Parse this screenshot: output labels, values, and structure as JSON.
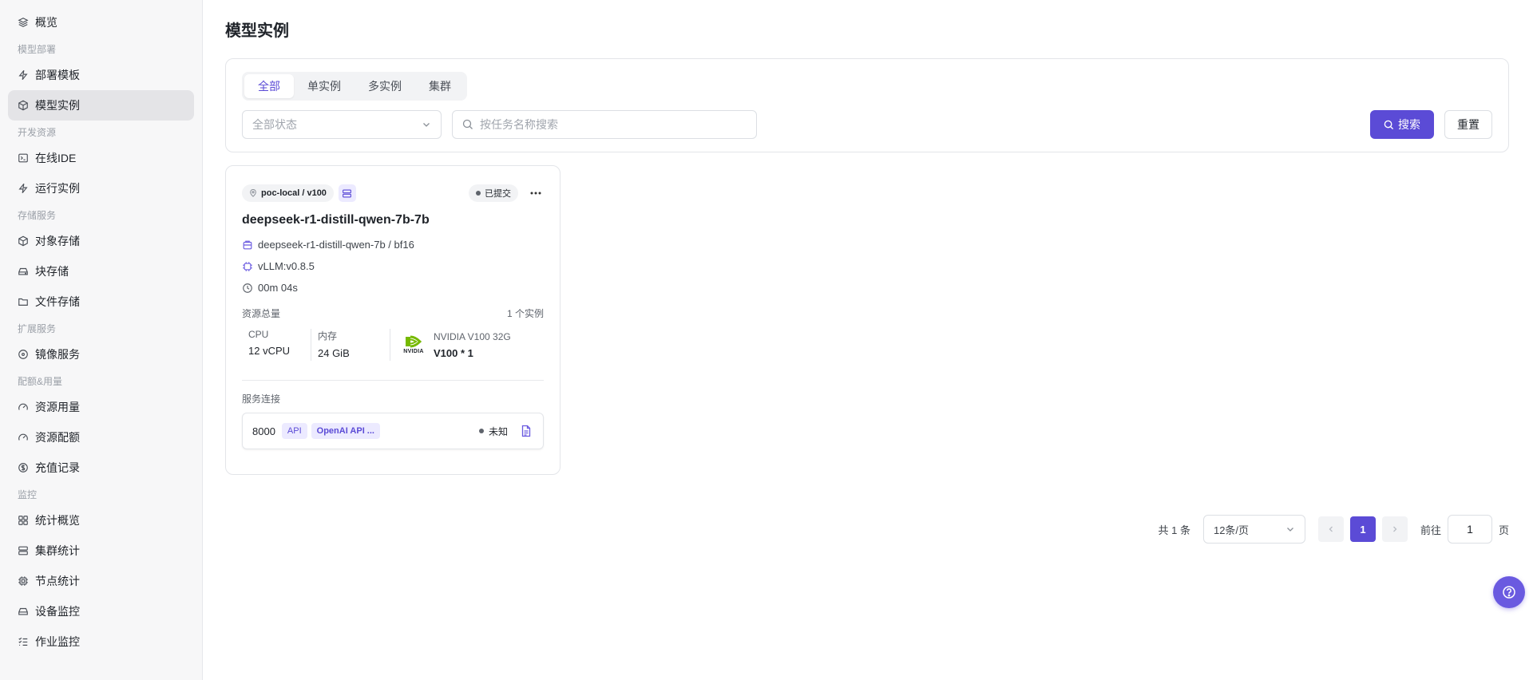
{
  "sidebar": {
    "overview": "概览",
    "groups": {
      "deploy": "模型部署",
      "dev": "开发资源",
      "storage": "存储服务",
      "ext": "扩展服务",
      "quota": "配额&用量",
      "monitor": "监控"
    },
    "items": {
      "deploy_template": "部署模板",
      "model_instance": "模型实例",
      "online_ide": "在线IDE",
      "run_instance": "运行实例",
      "object_storage": "对象存储",
      "block_storage": "块存储",
      "file_storage": "文件存储",
      "image_service": "镜像服务",
      "resource_usage": "资源用量",
      "resource_quota": "资源配额",
      "recharge_records": "充值记录",
      "stats_overview": "统计概览",
      "cluster_stats": "集群统计",
      "node_stats": "节点统计",
      "device_monitor": "设备监控",
      "job_monitor": "作业监控"
    }
  },
  "page": {
    "title": "模型实例"
  },
  "filters": {
    "tabs": [
      "全部",
      "单实例",
      "多实例",
      "集群"
    ],
    "active_tab": "全部",
    "status_select": "全部状态",
    "search_placeholder": "按任务名称搜索",
    "search_value": "",
    "search_button": "搜索",
    "reset_button": "重置"
  },
  "card": {
    "location": "poc-local / v100",
    "status": "已提交",
    "title": "deepseek-r1-distill-qwen-7b-7b",
    "model": "deepseek-r1-distill-qwen-7b / bf16",
    "runtime": "vLLM:v0.8.5",
    "duration": "00m 04s",
    "resources_label": "资源总量",
    "instances": "1 个实例",
    "cpu_label": "CPU",
    "cpu_value": "12 vCPU",
    "mem_label": "内存",
    "mem_value": "24 GiB",
    "gpu_label": "NVIDIA V100 32G",
    "gpu_value": "V100 * 1",
    "gpu_brand": "NVIDIA",
    "service_label": "服务连接",
    "service": {
      "port": "8000",
      "chip_api": "API",
      "chip_openai": "OpenAI API ...",
      "status": "未知"
    }
  },
  "pagination": {
    "total": "共 1 条",
    "page_size": "12条/页",
    "current_page": "1",
    "goto_label": "前往",
    "goto_value": "1",
    "page_suffix": "页"
  },
  "colors": {
    "accent": "#5b4bd6",
    "nvidia_green": "#76b900"
  }
}
